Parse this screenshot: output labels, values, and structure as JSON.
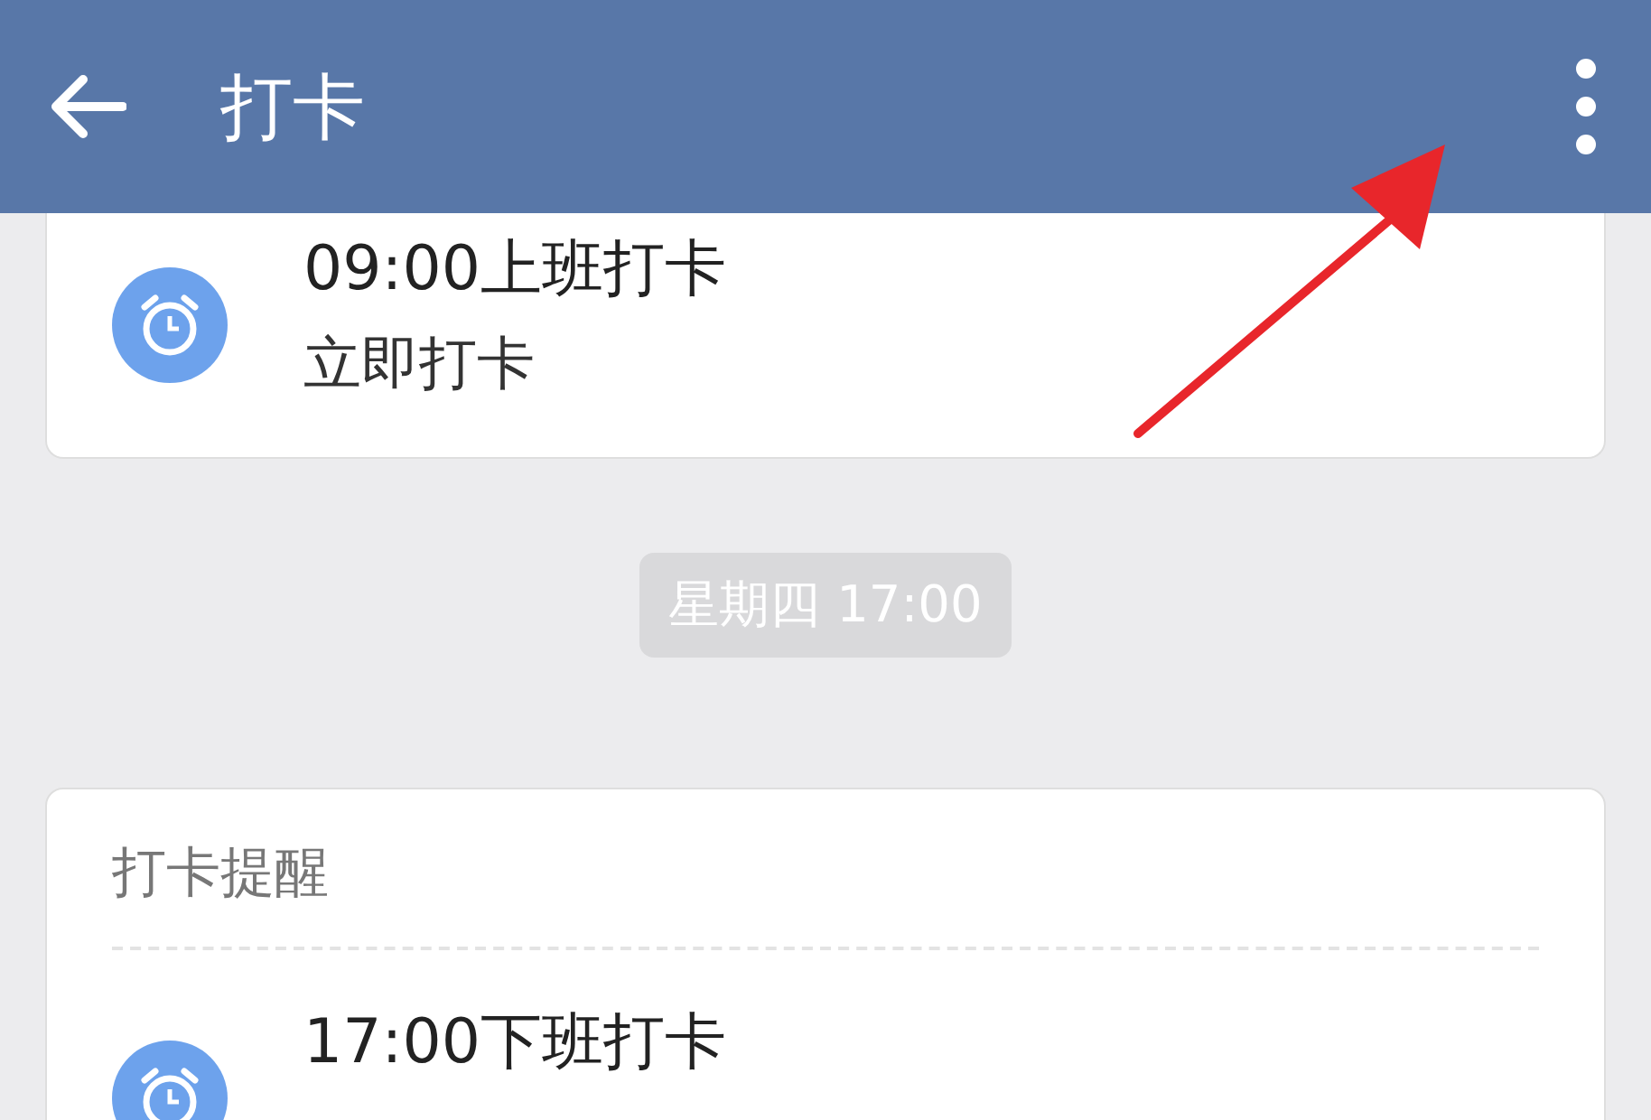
{
  "header": {
    "title": "打卡"
  },
  "feed": [
    {
      "kind": "card",
      "entries": [
        {
          "title": "09:00上班打卡",
          "action": "立即打卡"
        }
      ]
    },
    {
      "kind": "timestamp",
      "text": "星期四 17:00"
    },
    {
      "kind": "card",
      "heading": "打卡提醒",
      "entries": [
        {
          "title": "17:00下班打卡"
        }
      ]
    }
  ]
}
